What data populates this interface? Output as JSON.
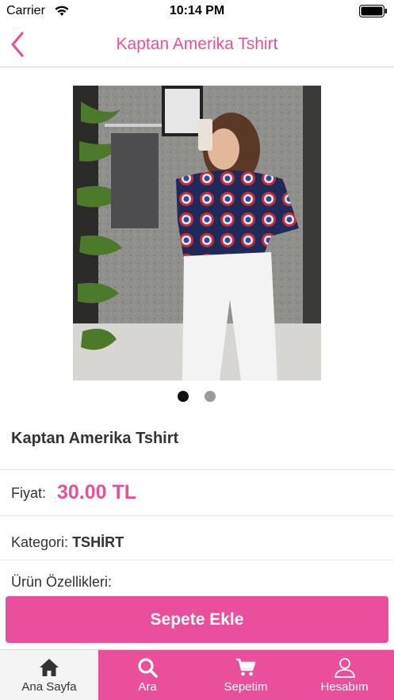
{
  "status_bar": {
    "carrier": "Carrier",
    "time": "10:14 PM"
  },
  "nav": {
    "title": "Kaptan Amerika Tshirt",
    "back_icon": "chevron-left-icon"
  },
  "product": {
    "image_alt": "",
    "gallery_dots": 2,
    "active_dot": 1,
    "name": "Kaptan Amerika Tshirt",
    "price_label": "Fiyat:",
    "price_value": "30.00 TL",
    "category_label": "Kategori:",
    "category_value": "TSHİRT",
    "features_label": "Ürün Özellikleri:"
  },
  "actions": {
    "add_to_cart": "Sepete Ekle"
  },
  "tab_bar": {
    "tabs": [
      {
        "label": "Ana Sayfa",
        "icon": "home-icon",
        "active": true
      },
      {
        "label": "Ara",
        "icon": "search-icon",
        "active": false
      },
      {
        "label": "Sepetim",
        "icon": "cart-icon",
        "active": false
      },
      {
        "label": "Hesabım",
        "icon": "user-icon",
        "active": false
      }
    ]
  },
  "colors": {
    "accent": "#ea4f9c",
    "tab_active_bg": "#f4f4f4"
  }
}
